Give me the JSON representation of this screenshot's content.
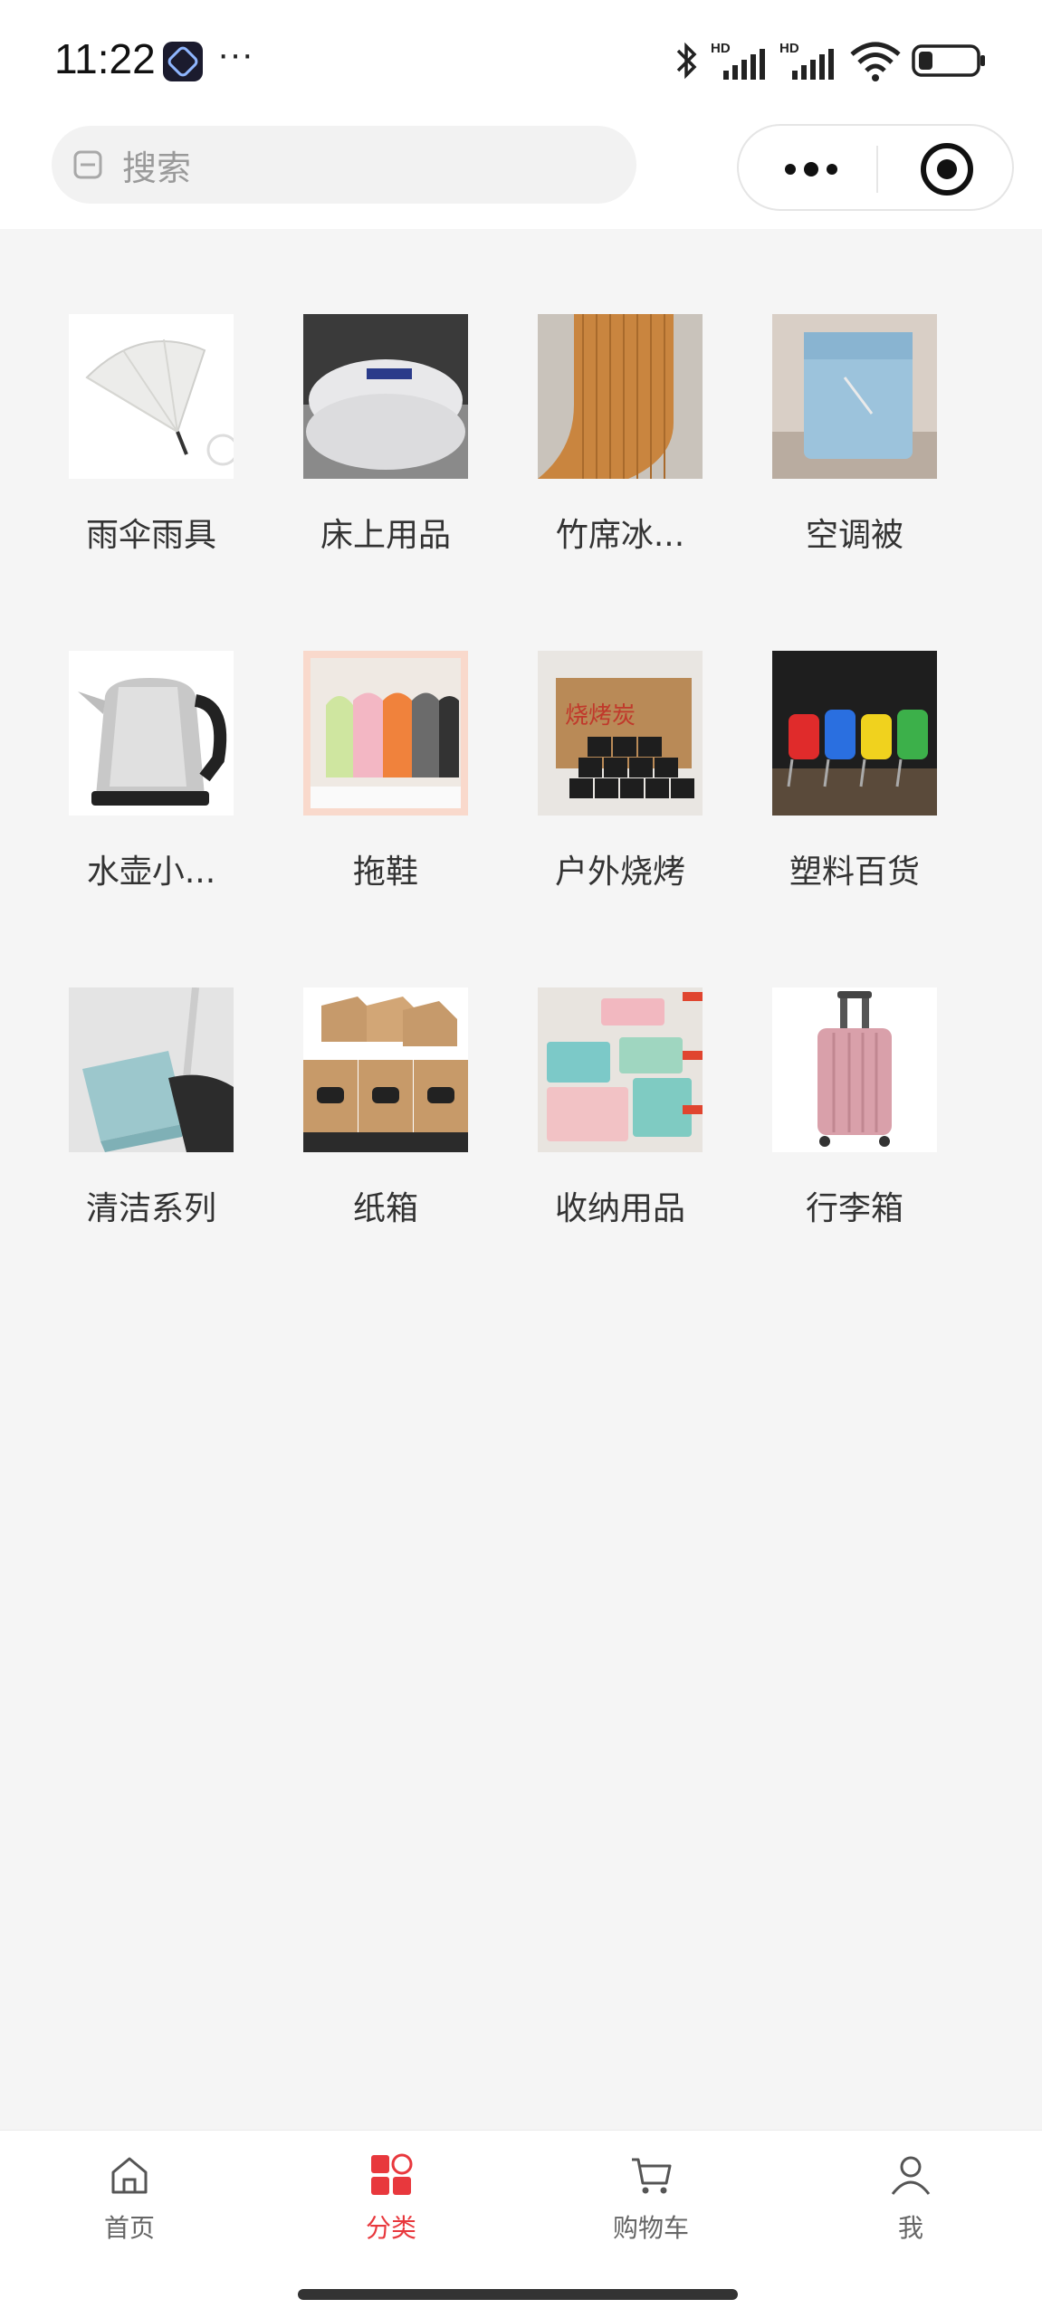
{
  "status": {
    "time": "11:22",
    "dots": "···",
    "battery_level": 0.25
  },
  "search": {
    "placeholder": "搜索"
  },
  "categories": [
    {
      "label": "雨伞雨具",
      "icon": "umbrella-image"
    },
    {
      "label": "床上用品",
      "icon": "bedding-image"
    },
    {
      "label": "竹席冰...",
      "icon": "bamboo-mat-image"
    },
    {
      "label": "空调被",
      "icon": "quilt-image"
    },
    {
      "label": "水壶小...",
      "icon": "kettle-image"
    },
    {
      "label": "拖鞋",
      "icon": "slippers-image"
    },
    {
      "label": "户外烧烤",
      "icon": "charcoal-image"
    },
    {
      "label": "塑料百货",
      "icon": "plastic-chairs-image"
    },
    {
      "label": "清洁系列",
      "icon": "dustpan-image"
    },
    {
      "label": "纸箱",
      "icon": "cardboard-box-image"
    },
    {
      "label": "收纳用品",
      "icon": "storage-box-image"
    },
    {
      "label": "行李箱",
      "icon": "suitcase-image"
    }
  ],
  "tabbar": {
    "tabs": [
      {
        "label": "首页",
        "icon": "home-icon"
      },
      {
        "label": "分类",
        "icon": "category-icon",
        "active": true
      },
      {
        "label": "购物车",
        "icon": "cart-icon"
      },
      {
        "label": "我",
        "icon": "user-icon"
      }
    ]
  },
  "colors": {
    "accent": "#e8383d",
    "background": "#f5f5f5",
    "text": "#333333"
  }
}
